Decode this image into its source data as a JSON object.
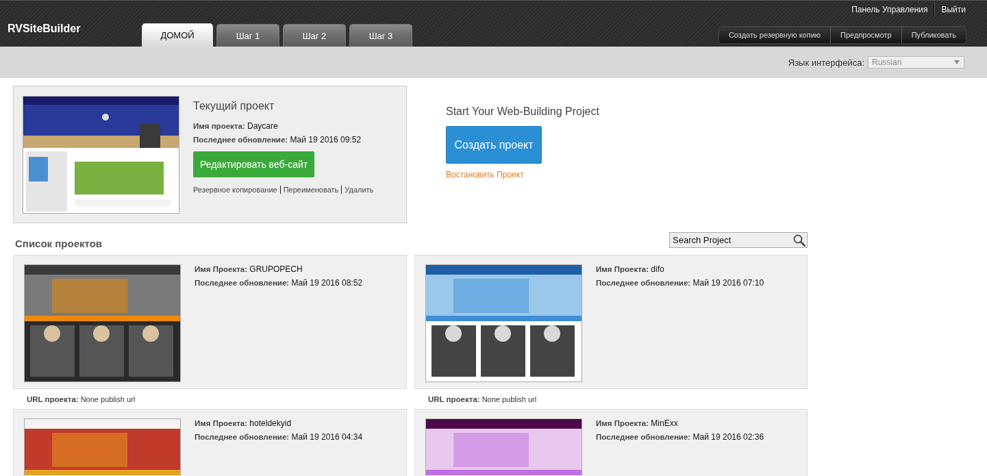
{
  "header": {
    "logo": "RVSiteBuilder",
    "top_links": [
      "Панель Управления",
      "Выйти"
    ],
    "tabs": [
      {
        "label": "ДОМОЙ",
        "selected": true
      },
      {
        "label": "Шаг 1",
        "selected": false
      },
      {
        "label": "Шаг 2",
        "selected": false
      },
      {
        "label": "Шаг 3",
        "selected": false
      }
    ],
    "actions": [
      "Создать резервную копию",
      "Предпросмотр",
      "Публиковать"
    ]
  },
  "language": {
    "label": "Язык интерфейса:",
    "value": "Russian"
  },
  "current_project": {
    "title": "Текущий проект",
    "name_label": "Имя проекта:",
    "name": "Daycare",
    "updated_label": "Последнее обновление:",
    "updated": "Май 19 2016 09:52",
    "edit_button": "Редактировать веб-сайт",
    "links": [
      "Резервное копирование",
      "Переименовать",
      "Удалить"
    ]
  },
  "start": {
    "title": "Start Your Web-Building Project",
    "create_button": "Создать проект",
    "restore_link": "Востановить Проект"
  },
  "projects": {
    "title": "Список проектов",
    "search": {
      "value": "Search Project"
    },
    "items": [
      {
        "name_label": "Имя Проекта:",
        "name": "GRUPOPECH",
        "updated_label": "Последнее обновление:",
        "updated": "Май 19 2016 08:52",
        "url_label": "URL проекта:",
        "url": "None publish url"
      },
      {
        "name_label": "Имя Проекта:",
        "name": "difo",
        "updated_label": "Последнее обновление:",
        "updated": "Май 19 2016 07:10",
        "url_label": "URL проекта:",
        "url": "None publish url"
      },
      {
        "name_label": "Имя Проекта:",
        "name": "hoteldekyid",
        "updated_label": "Последнее обновление:",
        "updated": "Май 19 2016 04:34"
      },
      {
        "name_label": "Имя Проекта:",
        "name": "MinExx",
        "updated_label": "Последнее обновление:",
        "updated": "Май 19 2016 02:36"
      }
    ]
  }
}
